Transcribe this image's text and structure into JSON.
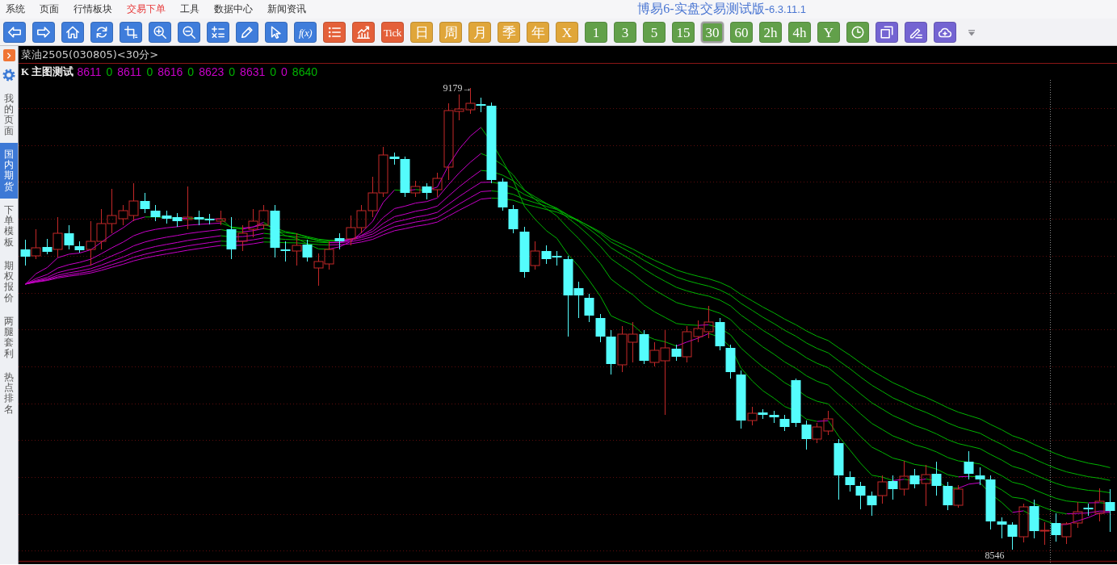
{
  "menu": [
    {
      "label": "系统",
      "selected": false
    },
    {
      "label": "页面",
      "selected": false
    },
    {
      "label": "行情板块",
      "selected": false
    },
    {
      "label": "交易下单",
      "selected": true
    },
    {
      "label": "工具",
      "selected": false
    },
    {
      "label": "数据中心",
      "selected": false
    },
    {
      "label": "新闻资讯",
      "selected": false
    }
  ],
  "window": {
    "title": "博易6-实盘交易测试版-",
    "version": "6.3.11.1"
  },
  "toolbar": {
    "tools": [
      {
        "color": "#3f7ddb"
      },
      {
        "color": "#3f7ddb"
      },
      {
        "color": "#3f7ddb"
      },
      {
        "color": "#3f7ddb"
      },
      {
        "color": "#3f7ddb"
      },
      {
        "color": "#3f7ddb"
      },
      {
        "color": "#3f7ddb"
      },
      {
        "color": "#3f7ddb"
      },
      {
        "color": "#3f7ddb"
      },
      {
        "color": "#3f7ddb"
      },
      {
        "color": "#3f7ddb",
        "label": "f(x)"
      },
      {
        "color": "#e4603a"
      },
      {
        "color": "#e4603a"
      }
    ],
    "periods": [
      {
        "label": "Tick",
        "color": "#e4603a",
        "selected": false
      },
      {
        "label": "日",
        "color": "#e0a63a",
        "selected": false
      },
      {
        "label": "周",
        "color": "#e0a63a",
        "selected": false
      },
      {
        "label": "月",
        "color": "#e0a63a",
        "selected": false
      },
      {
        "label": "季",
        "color": "#e0a63a",
        "selected": false
      },
      {
        "label": "年",
        "color": "#e0a63a",
        "selected": false
      },
      {
        "label": "X",
        "color": "#e0a63a",
        "selected": false
      },
      {
        "label": "1",
        "color": "#62a04a",
        "selected": false
      },
      {
        "label": "3",
        "color": "#62a04a",
        "selected": false
      },
      {
        "label": "5",
        "color": "#62a04a",
        "selected": false
      },
      {
        "label": "15",
        "color": "#62a04a",
        "selected": false
      },
      {
        "label": "30",
        "color": "#62a04a",
        "selected": true
      },
      {
        "label": "60",
        "color": "#62a04a",
        "selected": false
      },
      {
        "label": "2h",
        "color": "#62a04a",
        "selected": false
      },
      {
        "label": "4h",
        "color": "#62a04a",
        "selected": false
      },
      {
        "label": "Y",
        "color": "#62a04a",
        "selected": false
      }
    ],
    "extras": [
      {
        "color": "#62a04a"
      },
      {
        "color": "#7464d2"
      },
      {
        "color": "#7464d2"
      },
      {
        "color": "#7464d2"
      }
    ]
  },
  "sidebar": {
    "tabs": [
      {
        "label": "我的页面",
        "selected": false
      },
      {
        "label": "国内期货",
        "selected": true
      },
      {
        "label": "下单模板",
        "selected": false
      },
      {
        "label": "期权报价",
        "selected": false
      },
      {
        "label": "两腿套利",
        "selected": false
      },
      {
        "label": "热点排名",
        "selected": false
      }
    ]
  },
  "chart": {
    "symbol": "菜油2505(030805)<30分>",
    "indicator": {
      "name": "K 主图测试",
      "values": [
        {
          "text": "8611",
          "color": "#c800c8"
        },
        {
          "text": "0",
          "color": "#00b400"
        },
        {
          "text": "8611",
          "color": "#c800c8"
        },
        {
          "text": "0",
          "color": "#00b400"
        },
        {
          "text": "8616",
          "color": "#c800c8"
        },
        {
          "text": "0",
          "color": "#00b400"
        },
        {
          "text": "8623",
          "color": "#c800c8"
        },
        {
          "text": "0",
          "color": "#00b400"
        },
        {
          "text": "8631",
          "color": "#c800c8"
        },
        {
          "text": "0",
          "color": "#00b400"
        },
        {
          "text": "0",
          "color": "#c800c8"
        },
        {
          "text": "8640",
          "color": "#00b400"
        }
      ]
    },
    "price_labels": [
      {
        "kind": "high",
        "text": "9179→"
      },
      {
        "kind": "low",
        "text": "8546"
      }
    ]
  }
}
